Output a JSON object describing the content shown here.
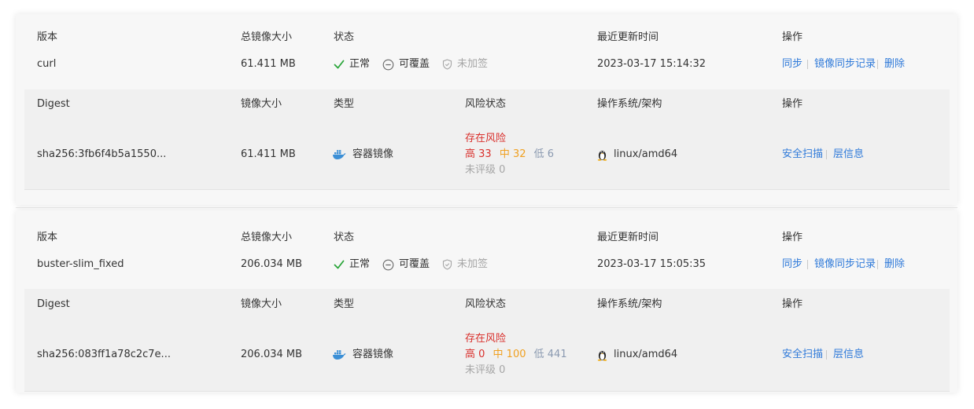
{
  "versions": [
    {
      "header": {
        "version": "版本",
        "total_size": "总镜像大小",
        "status": "状态",
        "updated": "最近更新时间",
        "ops": "操作"
      },
      "version": "curl",
      "total_size": "61.411 MB",
      "status": [
        {
          "label": "正常",
          "icon": "check-icon"
        },
        {
          "label": "可覆盖",
          "icon": "minus-circle-icon"
        },
        {
          "label": "未加签",
          "icon": "shield-icon"
        }
      ],
      "updated": "2023-03-17 15:14:32",
      "actions": [
        "同步",
        "镜像同步记录",
        "删除"
      ],
      "digest_header": {
        "digest": "Digest",
        "size": "镜像大小",
        "type": "类型",
        "risk": "风险状态",
        "os": "操作系统/架构",
        "ops": "操作"
      },
      "digest": {
        "hash": "sha256:3fb6f4b5a1550...",
        "size": "61.411 MB",
        "type": "容器镜像",
        "risk_title": "存在风险",
        "risk_high": "高 33",
        "risk_mid": "中 32",
        "risk_low": "低 6",
        "risk_unrated": "未评级 0",
        "os": "linux/amd64",
        "actions": [
          "安全扫描",
          "层信息"
        ]
      }
    },
    {
      "header": {
        "version": "版本",
        "total_size": "总镜像大小",
        "status": "状态",
        "updated": "最近更新时间",
        "ops": "操作"
      },
      "version": "buster-slim_fixed",
      "total_size": "206.034 MB",
      "status": [
        {
          "label": "正常",
          "icon": "check-icon"
        },
        {
          "label": "可覆盖",
          "icon": "minus-circle-icon"
        },
        {
          "label": "未加签",
          "icon": "shield-icon"
        }
      ],
      "updated": "2023-03-17 15:05:35",
      "actions": [
        "同步",
        "镜像同步记录",
        "删除"
      ],
      "digest_header": {
        "digest": "Digest",
        "size": "镜像大小",
        "type": "类型",
        "risk": "风险状态",
        "os": "操作系统/架构",
        "ops": "操作"
      },
      "digest": {
        "hash": "sha256:083ff1a78c2c7e...",
        "size": "206.034 MB",
        "type": "容器镜像",
        "risk_title": "存在风险",
        "risk_high": "高 0",
        "risk_mid": "中 100",
        "risk_low": "低 441",
        "risk_unrated": "未评级 0",
        "os": "linux/amd64",
        "actions": [
          "安全扫描",
          "层信息"
        ]
      }
    }
  ],
  "colors": {
    "link": "#2f7ad9",
    "check": "#2aa53a",
    "risk_red": "#d9302c",
    "risk_orange": "#f0a020",
    "risk_low": "#8a99b0",
    "docker": "#3b8fd6"
  }
}
